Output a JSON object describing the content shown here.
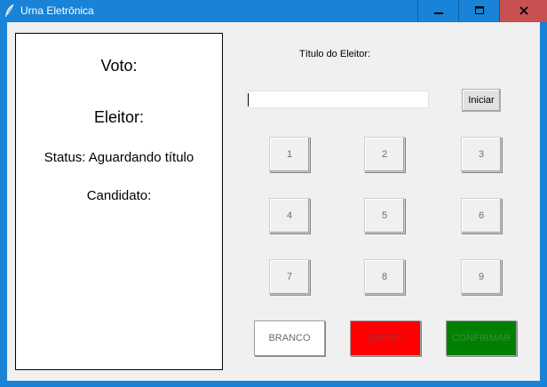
{
  "window": {
    "title": "Urna Eletrônica",
    "controls": [
      "minimize",
      "maximize",
      "close"
    ]
  },
  "left_panel": {
    "voto_label": "Voto:",
    "eleitor_label": "Eleitor:",
    "status_label": "Status: Aguardando título",
    "candidato_label": "Candidato:"
  },
  "form": {
    "titulo_label": "Título do Eleitor:",
    "titulo_value": "",
    "iniciar_label": "Iniciar"
  },
  "keypad": [
    "1",
    "2",
    "3",
    "4",
    "5",
    "6",
    "7",
    "8",
    "9"
  ],
  "actions": {
    "branco": "BRANCO",
    "limpar": "LIMPAR",
    "confirmar": "CONFIRMAR"
  },
  "colors": {
    "titlebar": "#1883d7",
    "close": "#c75050",
    "limpar": "#ff0000",
    "confirmar": "#008000"
  }
}
